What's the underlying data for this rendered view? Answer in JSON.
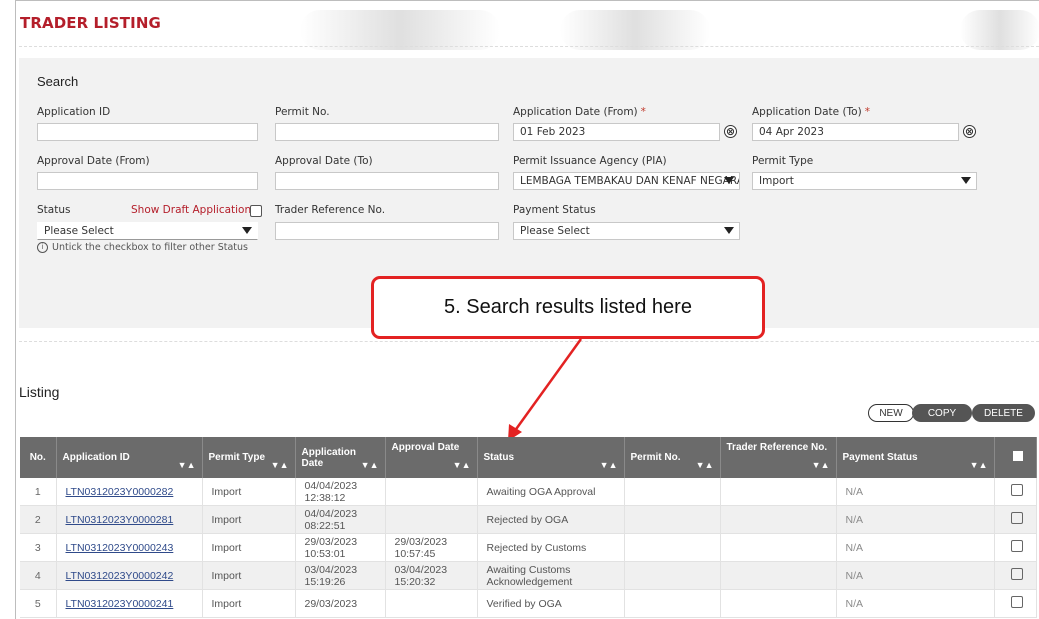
{
  "page": {
    "title": "TRADER LISTING"
  },
  "search": {
    "heading": "Search",
    "required_marker": "*",
    "application_id": {
      "label": "Application ID",
      "value": ""
    },
    "permit_no": {
      "label": "Permit No.",
      "value": ""
    },
    "application_date_from": {
      "label": "Application Date (From)",
      "value": "01 Feb 2023"
    },
    "application_date_to": {
      "label": "Application Date (To)",
      "value": "04 Apr 2023"
    },
    "approval_date_from": {
      "label": "Approval Date (From)",
      "value": ""
    },
    "approval_date_to": {
      "label": "Approval Date (To)",
      "value": ""
    },
    "pia": {
      "label": "Permit Issuance Agency (PIA)",
      "value": "LEMBAGA TEMBAKAU DAN KENAF NEGARA"
    },
    "permit_type": {
      "label": "Permit Type",
      "value": "Import"
    },
    "status": {
      "label": "Status",
      "value": "Please Select"
    },
    "show_draft": {
      "label": "Show Draft Applications",
      "checked": false
    },
    "trader_reference": {
      "label": "Trader Reference No.",
      "value": ""
    },
    "payment_status": {
      "label": "Payment Status",
      "value": "Please Select"
    },
    "hint": "Untick the checkbox to filter other Status",
    "clear_glyph": "⊗"
  },
  "callout": {
    "text": "5.  Search results listed here",
    "color": "#e32222"
  },
  "listing": {
    "heading": "Listing",
    "buttons": {
      "new": "NEW",
      "copy": "COPY",
      "delete": "DELETE"
    },
    "sort_glyph": "▼▲",
    "columns": {
      "no": "No.",
      "application_id": "Application ID",
      "permit_type": "Permit Type",
      "application_date": "Application Date",
      "approval_date": "Approval Date",
      "status": "Status",
      "permit_no": "Permit No.",
      "trader_ref": "Trader Reference No.",
      "payment_status": "Payment Status"
    },
    "rows": [
      {
        "no": "1",
        "app_id": "LTN0312023Y0000282",
        "permit_type": "Import",
        "app_date": "04/04/2023",
        "app_time": "12:38:12",
        "appr_date": "",
        "appr_time": "",
        "status": "Awaiting OGA Approval",
        "permit_no": "",
        "trader_ref": "",
        "payment": "N/A"
      },
      {
        "no": "2",
        "app_id": "LTN0312023Y0000281",
        "permit_type": "Import",
        "app_date": "04/04/2023",
        "app_time": "08:22:51",
        "appr_date": "",
        "appr_time": "",
        "status": "Rejected by OGA",
        "permit_no": "",
        "trader_ref": "",
        "payment": "N/A"
      },
      {
        "no": "3",
        "app_id": "LTN0312023Y0000243",
        "permit_type": "Import",
        "app_date": "29/03/2023",
        "app_time": "10:53:01",
        "appr_date": "29/03/2023",
        "appr_time": "10:57:45",
        "status": "Rejected by Customs",
        "permit_no": "",
        "trader_ref": "",
        "payment": "N/A"
      },
      {
        "no": "4",
        "app_id": "LTN0312023Y0000242",
        "permit_type": "Import",
        "app_date": "03/04/2023",
        "app_time": "15:19:26",
        "appr_date": "03/04/2023",
        "appr_time": "15:20:32",
        "status": "Awaiting Customs Acknowledgement",
        "permit_no": "",
        "trader_ref": "",
        "payment": "N/A"
      },
      {
        "no": "5",
        "app_id": "LTN0312023Y0000241",
        "permit_type": "Import",
        "app_date": "29/03/2023",
        "app_time": "",
        "appr_date": "",
        "appr_time": "",
        "status": "Verified by OGA",
        "permit_no": "",
        "trader_ref": "",
        "payment": "N/A"
      }
    ]
  }
}
